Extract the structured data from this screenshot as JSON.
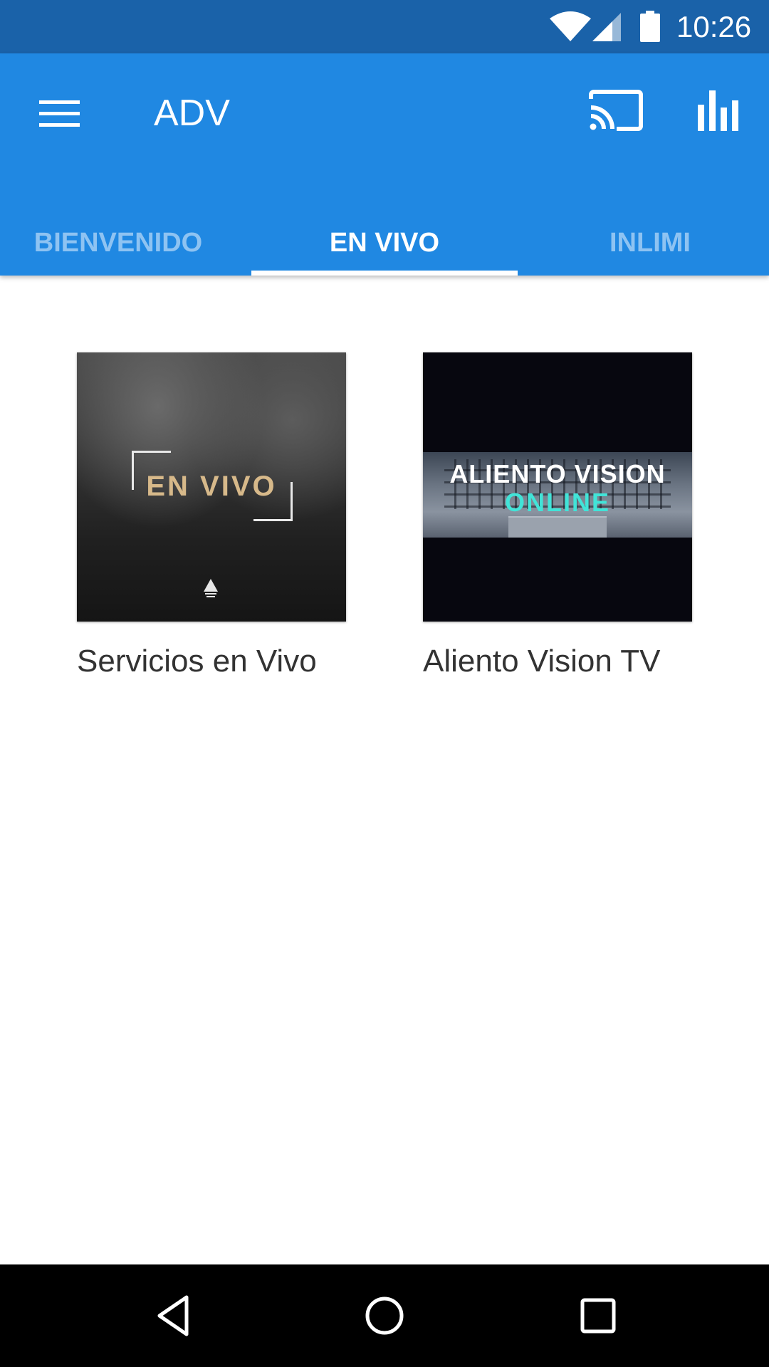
{
  "status_bar": {
    "time": "10:26",
    "icons": [
      "wifi-icon",
      "cell-signal-icon",
      "battery-icon"
    ]
  },
  "app_bar": {
    "title": "ADV",
    "icons": [
      "menu-icon",
      "cast-icon",
      "bar-chart-icon"
    ],
    "color": "#2088e2"
  },
  "tabs": [
    {
      "label": "BIENVENIDO",
      "selected": false
    },
    {
      "label": "EN VIVO",
      "selected": true
    },
    {
      "label": "INLIMI",
      "selected": false
    }
  ],
  "cards": [
    {
      "label": "Servicios en Vivo",
      "thumbnail_text": "EN VIVO"
    },
    {
      "label": "Aliento Vision TV",
      "thumbnail_text_line1": "ALIENTO VISION",
      "thumbnail_text_line2": "ONLINE"
    }
  ],
  "nav_bar": {
    "icons": [
      "back-icon",
      "home-icon",
      "recents-icon"
    ]
  },
  "colors": {
    "status_bar": "#1a62a9",
    "primary": "#2088e2",
    "tab_inactive": "#8ec3f2",
    "accent_teal": "#41e4d8",
    "gold": "#d7b98a"
  }
}
